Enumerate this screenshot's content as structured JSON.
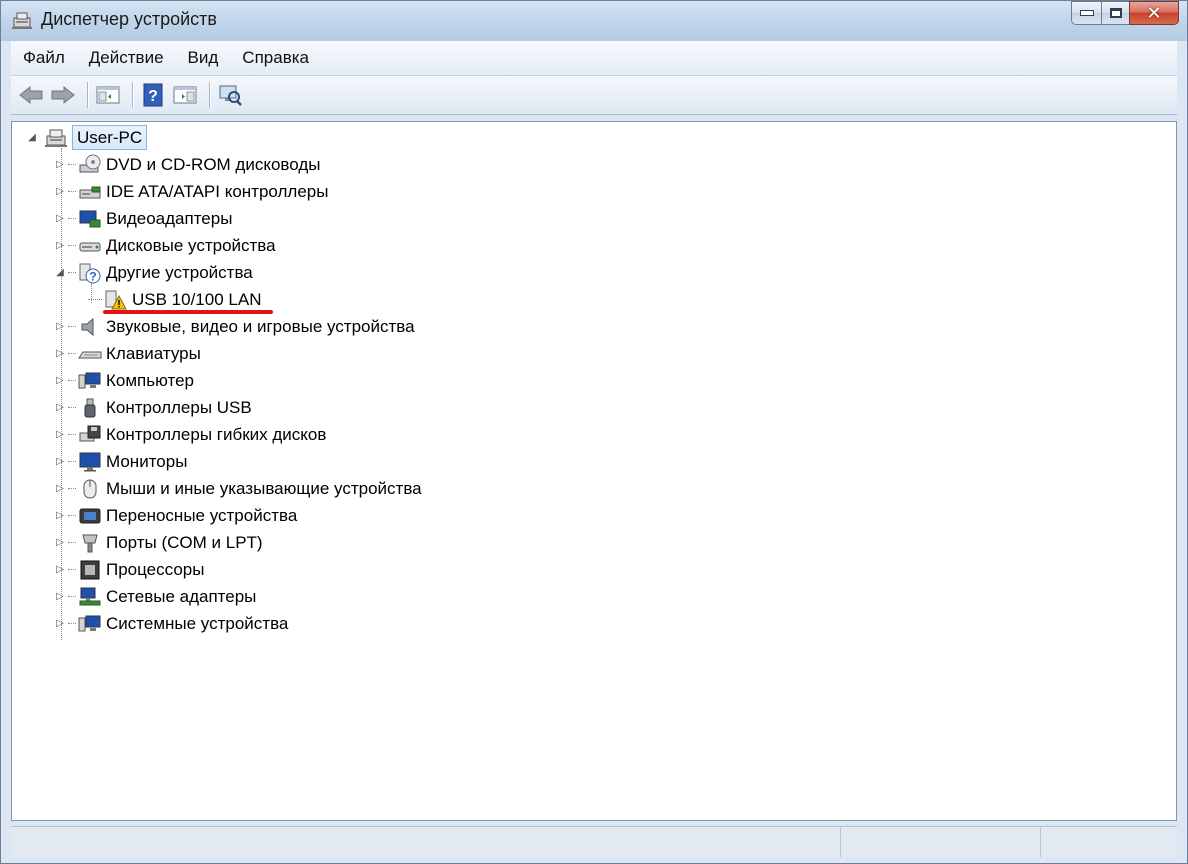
{
  "window": {
    "title": "Диспетчер устройств",
    "close_glyph": "✕"
  },
  "menu": [
    {
      "label": "Файл"
    },
    {
      "label": "Действие"
    },
    {
      "label": "Вид"
    },
    {
      "label": "Справка"
    }
  ],
  "toolbar": {
    "buttons": [
      "back-icon",
      "forward-icon",
      "console-tree-icon",
      "help-icon",
      "action-pane-icon",
      "scan-hardware-icon"
    ]
  },
  "tree": {
    "root": {
      "label": "User-PC",
      "expanded": true
    },
    "items": [
      {
        "label": "DVD и CD-ROM дисководы",
        "icon": "dvd-drive-icon",
        "expanded": false
      },
      {
        "label": "IDE ATA/ATAPI контроллеры",
        "icon": "ide-controller-icon",
        "expanded": false
      },
      {
        "label": "Видеоадаптеры",
        "icon": "display-adapter-icon",
        "expanded": false
      },
      {
        "label": "Дисковые устройства",
        "icon": "disk-drive-icon",
        "expanded": false
      },
      {
        "label": "Другие устройства",
        "icon": "unknown-device-icon",
        "expanded": true,
        "children": [
          {
            "label": "USB 10/100 LAN",
            "icon": "warning-device-icon",
            "status": "warning"
          }
        ]
      },
      {
        "label": "Звуковые, видео и игровые устройства",
        "icon": "speaker-icon",
        "expanded": false
      },
      {
        "label": "Клавиатуры",
        "icon": "keyboard-icon",
        "expanded": false
      },
      {
        "label": "Компьютер",
        "icon": "computer-icon",
        "expanded": false
      },
      {
        "label": "Контроллеры USB",
        "icon": "usb-icon",
        "expanded": false
      },
      {
        "label": "Контроллеры гибких дисков",
        "icon": "floppy-controller-icon",
        "expanded": false
      },
      {
        "label": "Мониторы",
        "icon": "monitor-icon",
        "expanded": false
      },
      {
        "label": "Мыши и иные указывающие устройства",
        "icon": "mouse-icon",
        "expanded": false
      },
      {
        "label": "Переносные устройства",
        "icon": "portable-device-icon",
        "expanded": false
      },
      {
        "label": "Порты (COM и LPT)",
        "icon": "port-icon",
        "expanded": false
      },
      {
        "label": "Процессоры",
        "icon": "processor-icon",
        "expanded": false
      },
      {
        "label": "Сетевые адаптеры",
        "icon": "network-adapter-icon",
        "expanded": false
      },
      {
        "label": "Системные устройства",
        "icon": "system-device-icon",
        "expanded": false
      }
    ]
  },
  "colors": {
    "highlight_underline": "#e0141a",
    "selection_border": "#8bb3dd"
  }
}
